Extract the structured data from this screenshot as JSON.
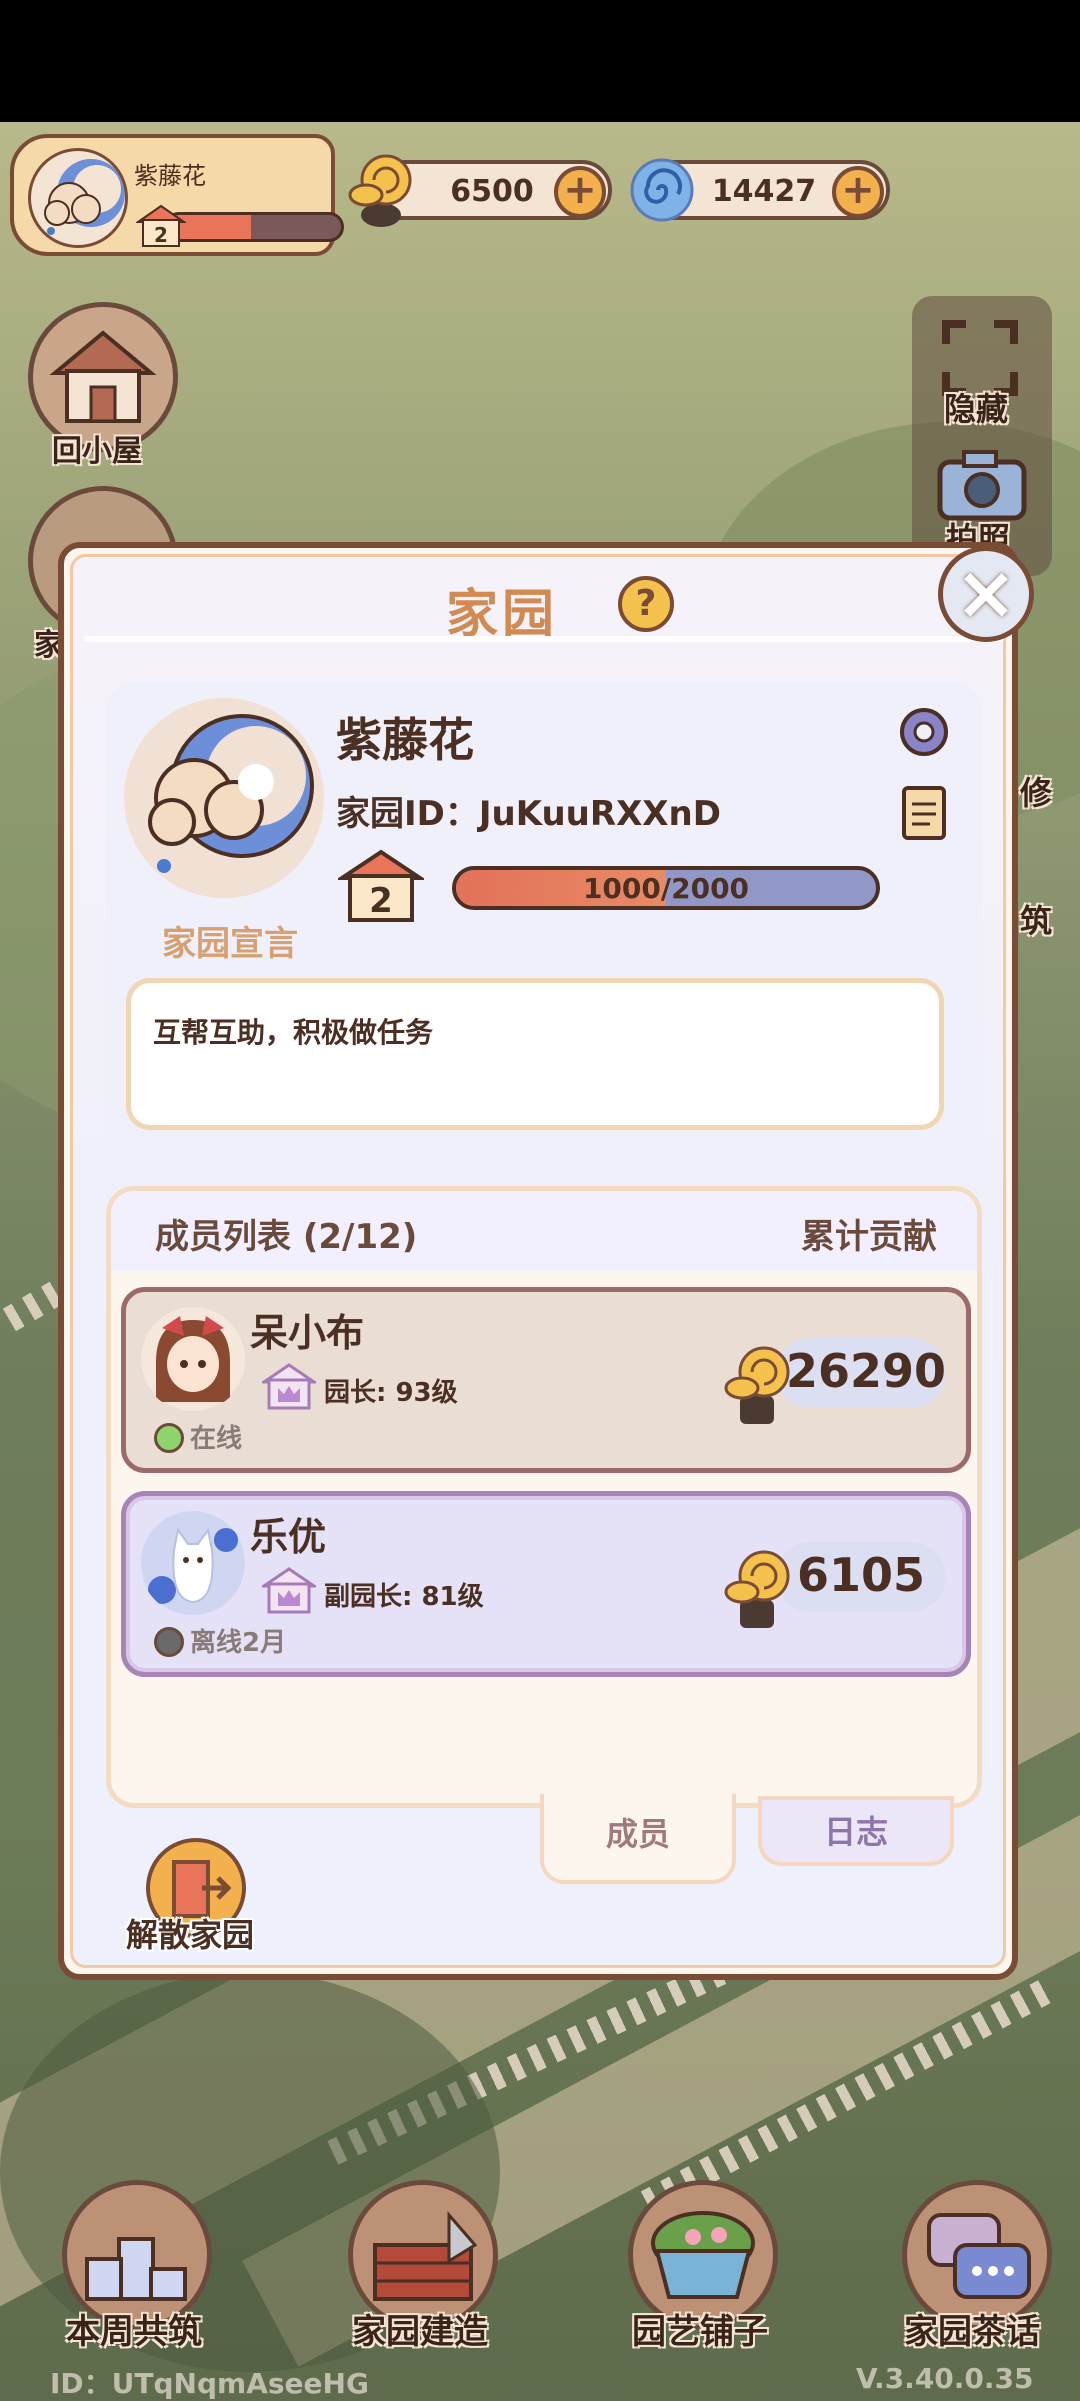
{
  "status_bar": {
    "player_name": "紫藤花",
    "player_level": "2",
    "level_progress": 0.48,
    "snail_currency": "6500",
    "swirl_currency": "14427"
  },
  "left_buttons": {
    "back_home": "回小屋",
    "home_partial": "家"
  },
  "right_buttons": {
    "hide": "隐藏",
    "photo": "拍照",
    "repair": "修",
    "build": "筑"
  },
  "dialog": {
    "title": "家园",
    "home_name": "紫藤花",
    "home_id_label": "家园ID：",
    "home_id": "JuKuuRXXnD",
    "home_level": "2",
    "exp_text": "1000/2000",
    "exp_fraction": 0.5,
    "declaration_label": "家园宣言",
    "declaration_text": "互帮互助，积极做任务",
    "members_title": "成员列表 (2/12)",
    "contribution_title": "累计贡献",
    "members": [
      {
        "name": "呆小布",
        "role": "园长: 93级",
        "status": "在线",
        "status_color": "#8fd46a",
        "contribution": "26290"
      },
      {
        "name": "乐优",
        "role": "副园长: 81级",
        "status": "离线2月",
        "status_color": "#6a6a6a",
        "contribution": "6105"
      }
    ],
    "tabs": {
      "members": "成员",
      "log": "日志"
    },
    "dissolve": "解散家园"
  },
  "bottom_nav": {
    "weekly_build": "本周共筑",
    "home_build": "家园建造",
    "garden_shop": "园艺铺子",
    "tea_chat": "家园茶话"
  },
  "footer": {
    "id": "ID：UTqNqmAseeHG",
    "version": "V.3.40.0.35"
  },
  "colors": {
    "accent": "#d08a52",
    "border_brown": "#7a4b35",
    "exp_fill": "#e2715a"
  }
}
